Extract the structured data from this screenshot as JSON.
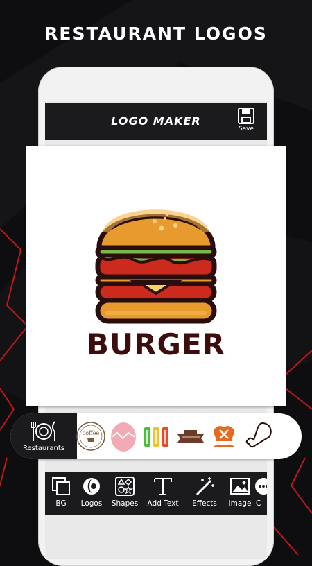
{
  "headline": "RESTAURANT LOGOS",
  "appbar": {
    "title": "LOGO MAKER",
    "save_label": "Save"
  },
  "canvas": {
    "logo_text": "BURGER",
    "logo_icon": "burger-icon"
  },
  "category_strip": {
    "active_label": "Restaurants",
    "active_icon": "plate-cutlery-icon",
    "thumbnails": [
      {
        "name": "coffee-logo",
        "text": "coffee"
      },
      {
        "name": "pink-egg-logo"
      },
      {
        "name": "fork-knife-spoon-logo"
      },
      {
        "name": "restaurant-banner-logo"
      },
      {
        "name": "chef-hat-mustache-logo"
      },
      {
        "name": "chicken-leg-logo"
      }
    ]
  },
  "toolbar": {
    "items": [
      {
        "label": "BG",
        "icon": "bg-squares-icon"
      },
      {
        "label": "Logos",
        "icon": "logos-swirl-icon"
      },
      {
        "label": "Shapes",
        "icon": "shapes-icon"
      },
      {
        "label": "Add Text",
        "icon": "text-t-icon"
      },
      {
        "label": "Effects",
        "icon": "magic-wand-icon"
      },
      {
        "label": "Image",
        "icon": "image-icon"
      },
      {
        "label": "C",
        "icon": "more-icon"
      }
    ]
  },
  "colors": {
    "background": "#0e0e10",
    "accent_red": "#c0161c",
    "dark_bar": "#1b1b1d",
    "logo_text": "#3d0c0c"
  }
}
